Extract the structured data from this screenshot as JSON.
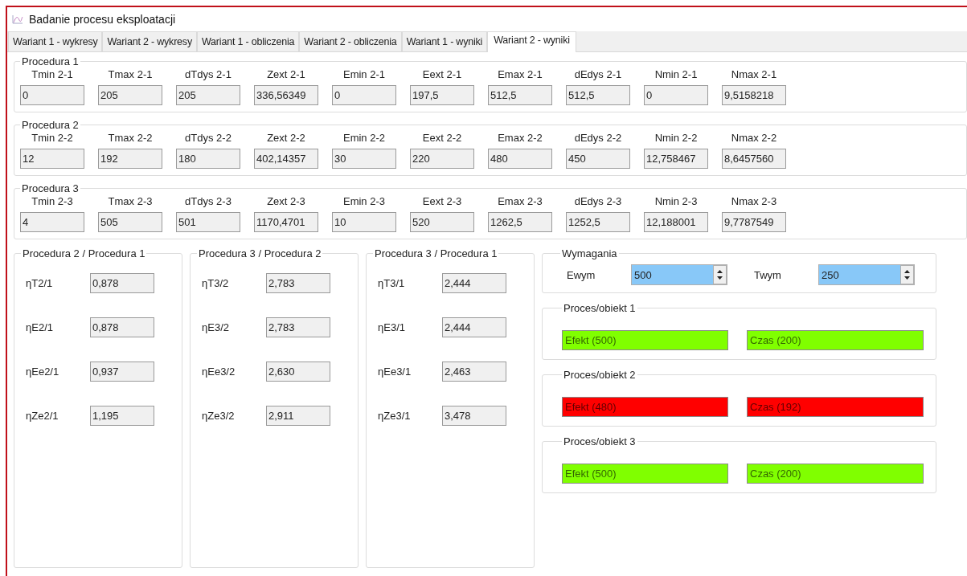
{
  "window": {
    "title": "Badanie procesu eksploatacji"
  },
  "tabs": [
    {
      "label": "Wariant 1 - wykresy",
      "selected": false
    },
    {
      "label": "Wariant 2 - wykresy",
      "selected": false
    },
    {
      "label": "Wariant 1 - obliczenia",
      "selected": false
    },
    {
      "label": "Wariant 2 - obliczenia",
      "selected": false
    },
    {
      "label": "Wariant 1 - wyniki",
      "selected": false
    },
    {
      "label": "Wariant 2 - wyniki",
      "selected": true
    }
  ],
  "procedures": [
    {
      "title": "Procedura 1",
      "fields": [
        {
          "label": "Tmin 2-1",
          "value": "0"
        },
        {
          "label": "Tmax 2-1",
          "value": "205"
        },
        {
          "label": "dTdys 2-1",
          "value": "205"
        },
        {
          "label": "Zext 2-1",
          "value": "336,56349"
        },
        {
          "label": "Emin 2-1",
          "value": "0"
        },
        {
          "label": "Eext 2-1",
          "value": "197,5"
        },
        {
          "label": "Emax 2-1",
          "value": "512,5"
        },
        {
          "label": "dEdys 2-1",
          "value": "512,5"
        },
        {
          "label": "Nmin 2-1",
          "value": "0"
        },
        {
          "label": "Nmax 2-1",
          "value": "9,5158218"
        }
      ]
    },
    {
      "title": "Procedura 2",
      "fields": [
        {
          "label": "Tmin 2-2",
          "value": "12"
        },
        {
          "label": "Tmax 2-2",
          "value": "192"
        },
        {
          "label": "dTdys 2-2",
          "value": "180"
        },
        {
          "label": "Zext 2-2",
          "value": "402,14357"
        },
        {
          "label": "Emin 2-2",
          "value": "30"
        },
        {
          "label": "Eext 2-2",
          "value": "220"
        },
        {
          "label": "Emax 2-2",
          "value": "480"
        },
        {
          "label": "dEdys 2-2",
          "value": "450"
        },
        {
          "label": "Nmin 2-2",
          "value": "12,758467"
        },
        {
          "label": "Nmax 2-2",
          "value": "8,6457560"
        }
      ]
    },
    {
      "title": "Procedura 3",
      "fields": [
        {
          "label": "Tmin 2-3",
          "value": "4"
        },
        {
          "label": "Tmax 2-3",
          "value": "505"
        },
        {
          "label": "dTdys 2-3",
          "value": "501"
        },
        {
          "label": "Zext 2-3",
          "value": "1170,4701"
        },
        {
          "label": "Emin 2-3",
          "value": "10"
        },
        {
          "label": "Eext 2-3",
          "value": "520"
        },
        {
          "label": "Emax 2-3",
          "value": "1262,5"
        },
        {
          "label": "dEdys 2-3",
          "value": "1252,5"
        },
        {
          "label": "Nmin 2-3",
          "value": "12,188001"
        },
        {
          "label": "Nmax 2-3",
          "value": "9,7787549"
        }
      ]
    }
  ],
  "ratios": [
    {
      "title": "Procedura 2 / Procedura 1",
      "rows": [
        {
          "label": "ηT2/1",
          "value": "0,878"
        },
        {
          "label": "ηE2/1",
          "value": "0,878"
        },
        {
          "label": "ηEe2/1",
          "value": "0,937"
        },
        {
          "label": "ηZe2/1",
          "value": "1,195"
        }
      ]
    },
    {
      "title": "Procedura 3 / Procedura 2",
      "rows": [
        {
          "label": "ηT3/2",
          "value": "2,783"
        },
        {
          "label": "ηE3/2",
          "value": "2,783"
        },
        {
          "label": "ηEe3/2",
          "value": "2,630"
        },
        {
          "label": "ηZe3/2",
          "value": "2,911"
        }
      ]
    },
    {
      "title": "Procedura 3 / Procedura 1",
      "rows": [
        {
          "label": "ηT3/1",
          "value": "2,444"
        },
        {
          "label": "ηE3/1",
          "value": "2,444"
        },
        {
          "label": "ηEe3/1",
          "value": "2,463"
        },
        {
          "label": "ηZe3/1",
          "value": "3,478"
        }
      ]
    }
  ],
  "requirements": {
    "title": "Wymagania",
    "inputs": [
      {
        "label": "Ewym",
        "value": "500"
      },
      {
        "label": "Twym",
        "value": "250"
      }
    ]
  },
  "processes": [
    {
      "title": "Proces/obiekt 1",
      "indicators": [
        {
          "text": "Efekt (500)",
          "color": "#80ff00"
        },
        {
          "text": "Czas (200)",
          "color": "#80ff00"
        }
      ]
    },
    {
      "title": "Proces/obiekt 2",
      "indicators": [
        {
          "text": "Efekt (480)",
          "color": "#ff0000"
        },
        {
          "text": "Czas (192)",
          "color": "#ff0000"
        }
      ]
    },
    {
      "title": "Proces/obiekt 3",
      "indicators": [
        {
          "text": "Efekt (500)",
          "color": "#80ff00"
        },
        {
          "text": "Czas (200)",
          "color": "#80ff00"
        }
      ]
    }
  ]
}
